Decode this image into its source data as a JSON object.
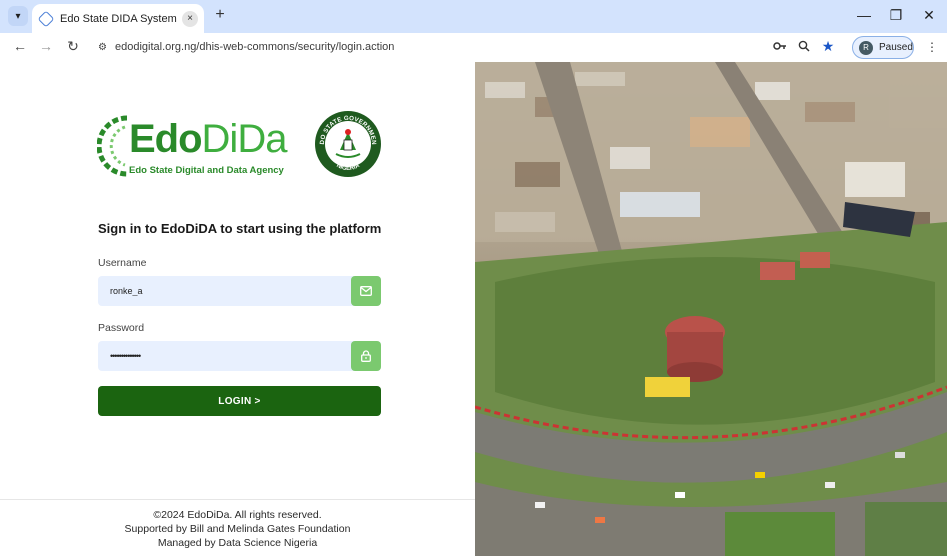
{
  "browser": {
    "tab_title": "Edo State DIDA System",
    "tab_close": "×",
    "new_tab": "+",
    "url": "edodigital.org.ng/dhis-web-commons/security/login.action",
    "profile_initial": "R",
    "profile_status": "Paused",
    "window_minimize": "—",
    "window_restore": "❐",
    "window_close": "✕",
    "back": "←",
    "forward": "→",
    "reload": "↻"
  },
  "logo": {
    "word_edo": "Edo",
    "word_dida": "DiDa",
    "subtitle": "Edo State Digital and Data Agency",
    "seal_top_text": "EDO STATE GOVERNMENT",
    "seal_bottom_text": "NIGERIA"
  },
  "login": {
    "heading": "Sign in to EdoDiDA to start using the platform",
    "username_label": "Username",
    "username_value": "ronke_a",
    "password_label": "Password",
    "password_value": "••••••••••••••",
    "login_button": "LOGIN >"
  },
  "footer": {
    "copyright": "©2024 EdoDiDa. All rights reserved.",
    "supported_by": "Supported by Bill and Melinda Gates Foundation",
    "managed_by": "Managed by Data Science Nigeria"
  },
  "icons": {
    "tab_menu": "chevron-down-icon",
    "favicon": "dhis-diamond-icon",
    "url_settings": "site-settings-icon",
    "password_key": "key-icon",
    "zoom": "zoom-icon",
    "bookmark": "star-icon",
    "menu": "kebab-menu-icon",
    "username_button": "mail-icon",
    "password_button": "lock-icon"
  },
  "colors": {
    "chrome_tabbar": "#d3e3fd",
    "brand_green_dark": "#1b6410",
    "brand_green_light": "#7bc96f",
    "field_bg": "#e8f0fe"
  }
}
